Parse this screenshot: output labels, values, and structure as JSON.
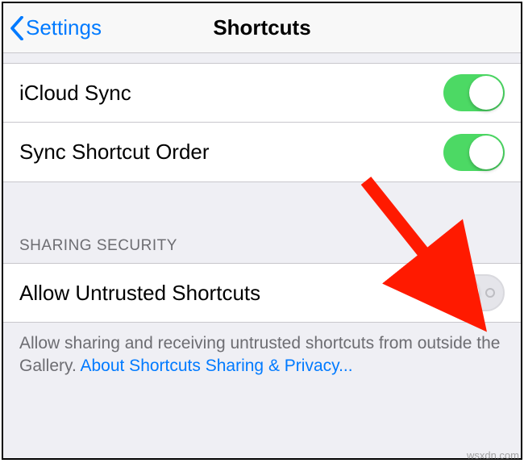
{
  "navbar": {
    "back_label": "Settings",
    "title": "Shortcuts"
  },
  "rows": {
    "icloud_sync": {
      "label": "iCloud Sync",
      "on": true
    },
    "sync_order": {
      "label": "Sync Shortcut Order",
      "on": true
    },
    "allow_untrusted": {
      "label": "Allow Untrusted Shortcuts",
      "on": false
    }
  },
  "section_header": "SHARING SECURITY",
  "footer": {
    "text": "Allow sharing and receiving untrusted shortcuts from outside the Gallery. ",
    "link": "About Shortcuts Sharing & Privacy..."
  },
  "watermark": "wsxdn.com"
}
